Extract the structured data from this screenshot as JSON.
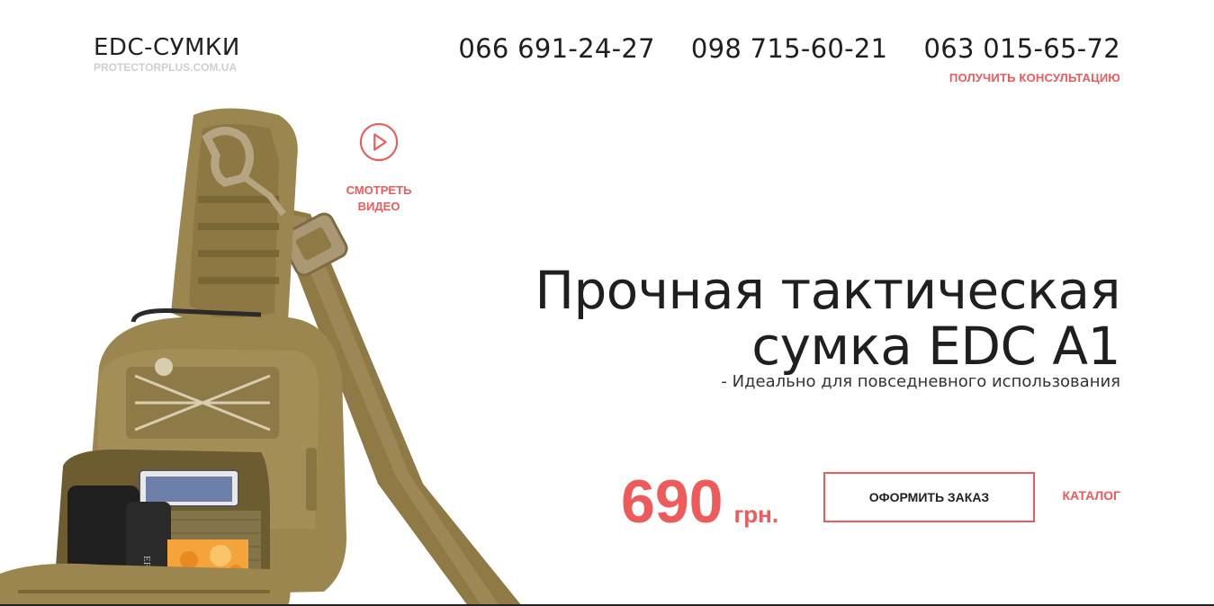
{
  "header": {
    "logo_title": "EDC-СУМКИ",
    "logo_domain": "PROTECTORPLUS.COM.UA",
    "phones": [
      "066 691-24-27",
      "098 715-60-21",
      "063 015-65-72"
    ],
    "consult_link": "ПОЛУЧИТЬ КОНСУЛЬТАЦИЮ"
  },
  "video": {
    "label": "СМОТРЕТЬ\nВИДЕО",
    "icon": "play-icon"
  },
  "hero": {
    "title_line1": "Прочная тактическая",
    "title_line2": "сумка EDC A1",
    "subtitle": "- Идеально для повседневного использования",
    "price_value": "690",
    "price_currency": "грн.",
    "order_button": "ОФОРМИТЬ ЗАКАЗ",
    "catalog_link": "КАТАЛОГ",
    "product_image_text": "EFOOL"
  },
  "colors": {
    "accent": "#ef5a5a",
    "text": "#1f1f1f",
    "muted": "#cfcfcf",
    "bag": "#9c8650"
  }
}
